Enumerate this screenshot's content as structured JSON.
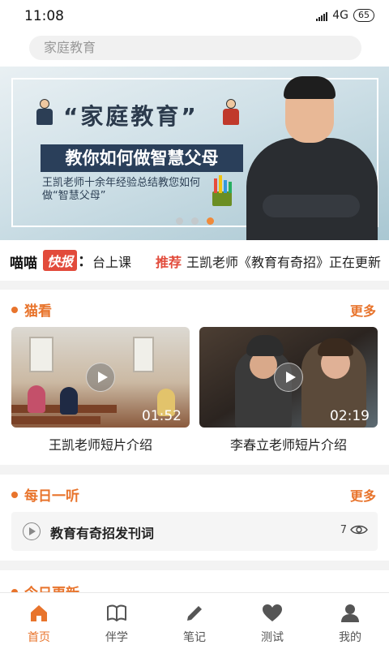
{
  "status_bar": {
    "time": "11:08",
    "network": "4G",
    "battery": "65"
  },
  "search": {
    "placeholder": "家庭教育"
  },
  "banner": {
    "quote_title": "“家庭教育”",
    "headline": "教你如何做智慧父母",
    "description": "王凯老师十余年经验总结教您如何做“智慧父母”",
    "slides": 3,
    "active_slide": 3
  },
  "ticker": {
    "brand": "喵喵",
    "badge": "快报",
    "colon": "：",
    "text_primary": "台上课",
    "tag": "推荐",
    "text_secondary": "王凯老师《教育有奇招》正在更新"
  },
  "sections": {
    "miao": {
      "title": "猫看",
      "more": "更多",
      "videos": [
        {
          "caption": "王凯老师短片介绍",
          "duration": "01:52"
        },
        {
          "caption": "李春立老师短片介绍",
          "duration": "02:19"
        }
      ]
    },
    "daily": {
      "title": "每日一听",
      "more": "更多",
      "item": {
        "title": "教育有奇招发刊词",
        "count": "7"
      }
    },
    "today": {
      "title": "今日更新"
    }
  },
  "tabs": [
    {
      "label": "首页",
      "icon": "home-icon",
      "active": true
    },
    {
      "label": "伴学",
      "icon": "book-icon",
      "active": false
    },
    {
      "label": "笔记",
      "icon": "pencil-icon",
      "active": false
    },
    {
      "label": "测试",
      "icon": "heart-icon",
      "active": false
    },
    {
      "label": "我的",
      "icon": "person-icon",
      "active": false
    }
  ],
  "colors": {
    "accent": "#e8742c",
    "ticker_red": "#e24b3b",
    "banner_navy": "#2a3f5a"
  }
}
